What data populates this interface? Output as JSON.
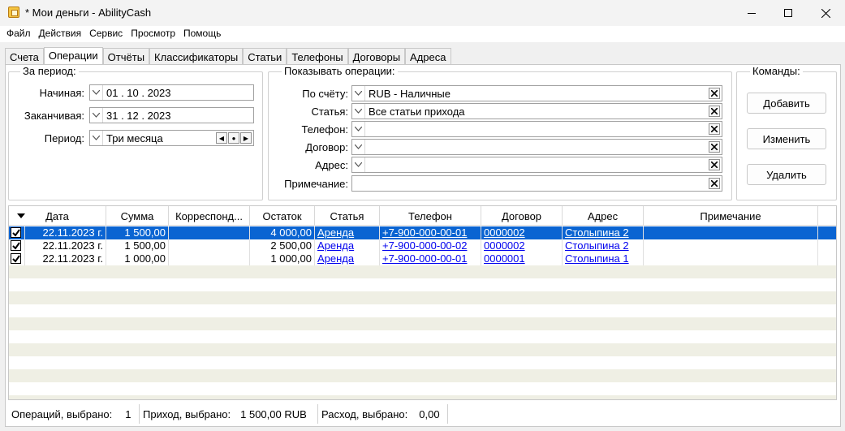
{
  "window": {
    "title": "* Мои деньги - AbilityCash"
  },
  "menu": [
    "Файл",
    "Действия",
    "Сервис",
    "Просмотр",
    "Помощь"
  ],
  "tabs": [
    "Счета",
    "Операции",
    "Отчёты",
    "Классификаторы",
    "Статьи",
    "Телефоны",
    "Договоры",
    "Адреса"
  ],
  "period_group": {
    "title": "За период:",
    "start_label": "Начиная:",
    "start_value": "01 . 10 . 2023",
    "end_label": "Заканчивая:",
    "end_value": "31 . 12 . 2023",
    "period_label": "Период:",
    "period_value": "Три месяца"
  },
  "filter_group": {
    "title": "Показывать операции:",
    "account_label": "По счёту:",
    "account_value": "RUB - Наличные",
    "article_label": "Статья:",
    "article_value": "Все статьи прихода",
    "phone_label": "Телефон:",
    "phone_value": "",
    "contract_label": "Договор:",
    "contract_value": "",
    "address_label": "Адрес:",
    "address_value": "",
    "note_label": "Примечание:",
    "note_value": ""
  },
  "commands_group": {
    "title": "Команды:",
    "add": "Добавить",
    "edit": "Изменить",
    "delete": "Удалить"
  },
  "grid": {
    "columns": [
      "Дата",
      "Сумма",
      "Корреспонд...",
      "Остаток",
      "Статья",
      "Телефон",
      "Договор",
      "Адрес",
      "Примечание"
    ],
    "rows": [
      {
        "checked": true,
        "date": "22.11.2023 г.",
        "sum": "1 500,00",
        "corr": "",
        "balance": "4 000,00",
        "article": "Аренда",
        "phone": "+7-900-000-00-01",
        "contract": "0000002",
        "address": "Столыпина 2",
        "note": "",
        "selected": true
      },
      {
        "checked": true,
        "date": "22.11.2023 г.",
        "sum": "1 500,00",
        "corr": "",
        "balance": "2 500,00",
        "article": "Аренда",
        "phone": "+7-900-000-00-02",
        "contract": "0000002",
        "address": "Столыпина 2",
        "note": "",
        "selected": false
      },
      {
        "checked": true,
        "date": "22.11.2023 г.",
        "sum": "1 000,00",
        "corr": "",
        "balance": "1 000,00",
        "article": "Аренда",
        "phone": "+7-900-000-00-01",
        "contract": "0000001",
        "address": "Столыпина 1",
        "note": "",
        "selected": false
      }
    ]
  },
  "status": {
    "ops_label": "Операций, выбрано:",
    "ops_value": "1",
    "income_label": "Приход, выбрано:",
    "income_value": "1 500,00 RUB",
    "expense_label": "Расход, выбрано:",
    "expense_value": "0,00"
  },
  "colors": {
    "selection": "#0a64d2",
    "alt_row": "#efefe4",
    "link": "#0000ee"
  }
}
